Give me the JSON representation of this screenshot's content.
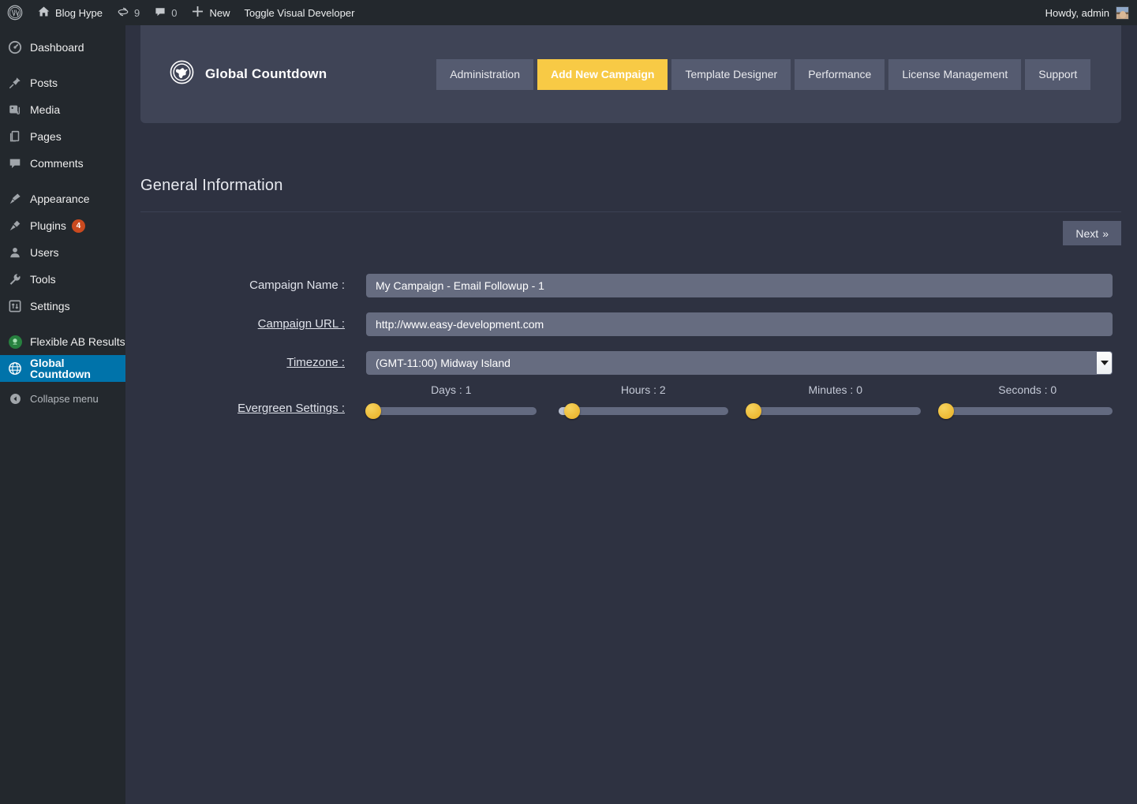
{
  "adminbar": {
    "logo_icon": "wordpress-logo-icon",
    "site_icon": "home-icon",
    "site_name": "Blog Hype",
    "updates_icon": "updates-icon",
    "updates_count": "9",
    "comments_icon": "comment-bubble-icon",
    "comments_count": "0",
    "new_icon": "plus-icon",
    "new_label": "New",
    "toggle_label": "Toggle Visual Developer",
    "howdy": "Howdy, admin",
    "avatar_icon": "avatar"
  },
  "sidebar": {
    "active_color": "#0073aa",
    "items": [
      {
        "label": "Dashboard",
        "icon": "dashboard-icon"
      },
      {
        "label": "Posts",
        "icon": "pin-icon"
      },
      {
        "label": "Media",
        "icon": "media-icon"
      },
      {
        "label": "Pages",
        "icon": "pages-icon"
      },
      {
        "label": "Comments",
        "icon": "comment-icon"
      },
      {
        "label": "Appearance",
        "icon": "brush-icon"
      },
      {
        "label": "Plugins",
        "icon": "plug-icon",
        "badge": "4"
      },
      {
        "label": "Users",
        "icon": "user-icon"
      },
      {
        "label": "Tools",
        "icon": "wrench-icon"
      },
      {
        "label": "Settings",
        "icon": "settings-icon"
      },
      {
        "label": "Flexible AB Results",
        "icon": "green-dot-icon"
      },
      {
        "label": "Global Countdown",
        "icon": "globe-icon"
      }
    ],
    "collapse_label": "Collapse menu",
    "collapse_icon": "collapse-arrow-icon"
  },
  "plugin": {
    "brand_icon": "globe-icon",
    "brand_name": "Global Countdown",
    "active_tab_color": "#f8ca45",
    "tabs": [
      {
        "label": "Administration",
        "active": false
      },
      {
        "label": "Add New Campaign",
        "active": true
      },
      {
        "label": "Template Designer",
        "active": false
      },
      {
        "label": "Performance",
        "active": false
      },
      {
        "label": "License Management",
        "active": false
      },
      {
        "label": "Support",
        "active": false
      }
    ]
  },
  "main": {
    "page_title": "General Information",
    "next_label": "Next",
    "next_icon": "double-chevron-right-icon",
    "fields": {
      "campaign_name_label": "Campaign Name :",
      "campaign_name_value": "My Campaign - Email Followup - 1",
      "campaign_url_label": "Campaign URL :",
      "campaign_url_value": "http://www.easy-development.com",
      "timezone_label": "Timezone :",
      "timezone_value": "(GMT-11:00) Midway Island",
      "evergreen_label": "Evergreen Settings :"
    },
    "sliders": [
      {
        "name": "Days",
        "caption": "Days : 1",
        "value": 1,
        "percent": 4
      },
      {
        "name": "Hours",
        "caption": "Hours : 2",
        "value": 2,
        "percent": 8
      },
      {
        "name": "Minutes",
        "caption": "Minutes : 0",
        "value": 0,
        "percent": 2
      },
      {
        "name": "Seconds",
        "caption": "Seconds : 0",
        "value": 0,
        "percent": 2
      }
    ]
  }
}
